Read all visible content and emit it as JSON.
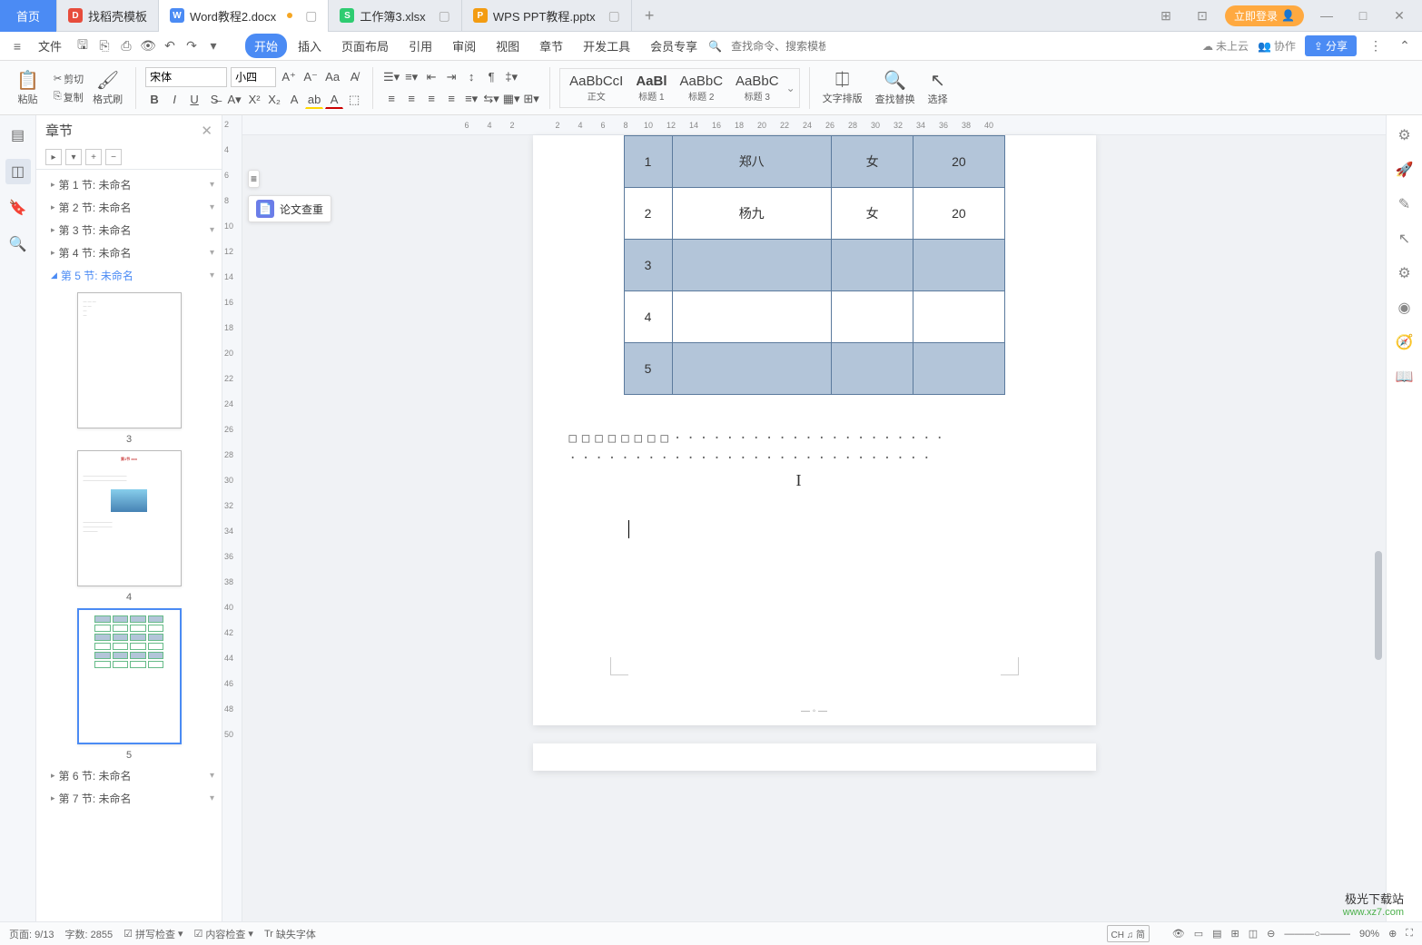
{
  "tabs": {
    "home": "首页",
    "items": [
      {
        "icon": "docker",
        "label": "找稻壳模板"
      },
      {
        "icon": "word",
        "label": "Word教程2.docx",
        "active": true,
        "modified": true
      },
      {
        "icon": "excel",
        "label": "工作簿3.xlsx"
      },
      {
        "icon": "ppt",
        "label": "WPS PPT教程.pptx"
      }
    ]
  },
  "titlebar_right": {
    "login": "立即登录"
  },
  "menubar": {
    "file": "文件",
    "items": [
      "开始",
      "插入",
      "页面布局",
      "引用",
      "审阅",
      "视图",
      "章节",
      "开发工具",
      "会员专享"
    ],
    "active": "开始",
    "search_placeholder": "查找命令、搜索模板",
    "cloud": "未上云",
    "collab": "协作",
    "share": "分享"
  },
  "ribbon": {
    "paste_row": {
      "cut": "剪切",
      "copy": "复制",
      "paste": "粘贴",
      "format_painter": "格式刷"
    },
    "font_name": "宋体",
    "font_size": "小四",
    "styles": [
      {
        "preview": "AaBbCcI",
        "name": "正文"
      },
      {
        "preview": "AaBl",
        "name": "标题 1"
      },
      {
        "preview": "AaBbC",
        "name": "标题 2"
      },
      {
        "preview": "AaBbC",
        "name": "标题 3"
      }
    ],
    "text_layout": "文字排版",
    "find_replace": "查找替换",
    "select": "选择"
  },
  "chapter_panel": {
    "title": "章节",
    "sections": [
      {
        "label": "第 1 节: 未命名"
      },
      {
        "label": "第 2 节: 未命名"
      },
      {
        "label": "第 3 节: 未命名"
      },
      {
        "label": "第 4 节: 未命名"
      },
      {
        "label": "第 5 节: 未命名",
        "active": true
      },
      {
        "label": "第 6 节: 未命名"
      },
      {
        "label": "第 7 节: 未命名"
      }
    ],
    "thumbs": [
      "3",
      "4",
      "5"
    ]
  },
  "ruler_h": [
    "6",
    "4",
    "2",
    "",
    "2",
    "4",
    "6",
    "8",
    "10",
    "12",
    "14",
    "16",
    "18",
    "20",
    "22",
    "24",
    "26",
    "28",
    "30",
    "32",
    "34",
    "36",
    "38",
    "40"
  ],
  "ruler_v": [
    "2",
    "4",
    "6",
    "8",
    "10",
    "12",
    "14",
    "16",
    "18",
    "20",
    "22",
    "24",
    "26",
    "28",
    "30",
    "32",
    "34",
    "36",
    "38",
    "40",
    "42",
    "44",
    "46",
    "48",
    "50"
  ],
  "document": {
    "table": {
      "rows": [
        {
          "shaded": true,
          "cells": [
            "1",
            "郑八",
            "女",
            "20"
          ]
        },
        {
          "shaded": false,
          "cells": [
            "2",
            "杨九",
            "女",
            "20"
          ]
        },
        {
          "shaded": true,
          "cells": [
            "3",
            "",
            "",
            ""
          ]
        },
        {
          "shaded": false,
          "cells": [
            "4",
            "",
            "",
            ""
          ]
        },
        {
          "shaded": true,
          "cells": [
            "5",
            "",
            "",
            ""
          ]
        }
      ]
    },
    "dots1": "□□□□□□□□·····················",
    "dots2": "····························"
  },
  "float_tool": {
    "icon": "≡",
    "label": "论文查重"
  },
  "statusbar": {
    "page": "页面: 9/13",
    "words": "字数: 2855",
    "spell": "拼写检查",
    "content_check": "内容检查",
    "missing_font": "缺失字体",
    "ime": "CH ♫ 简",
    "zoom": "90%"
  },
  "watermark": {
    "line1": "极光下载站",
    "line2": "www.xz7.com"
  }
}
